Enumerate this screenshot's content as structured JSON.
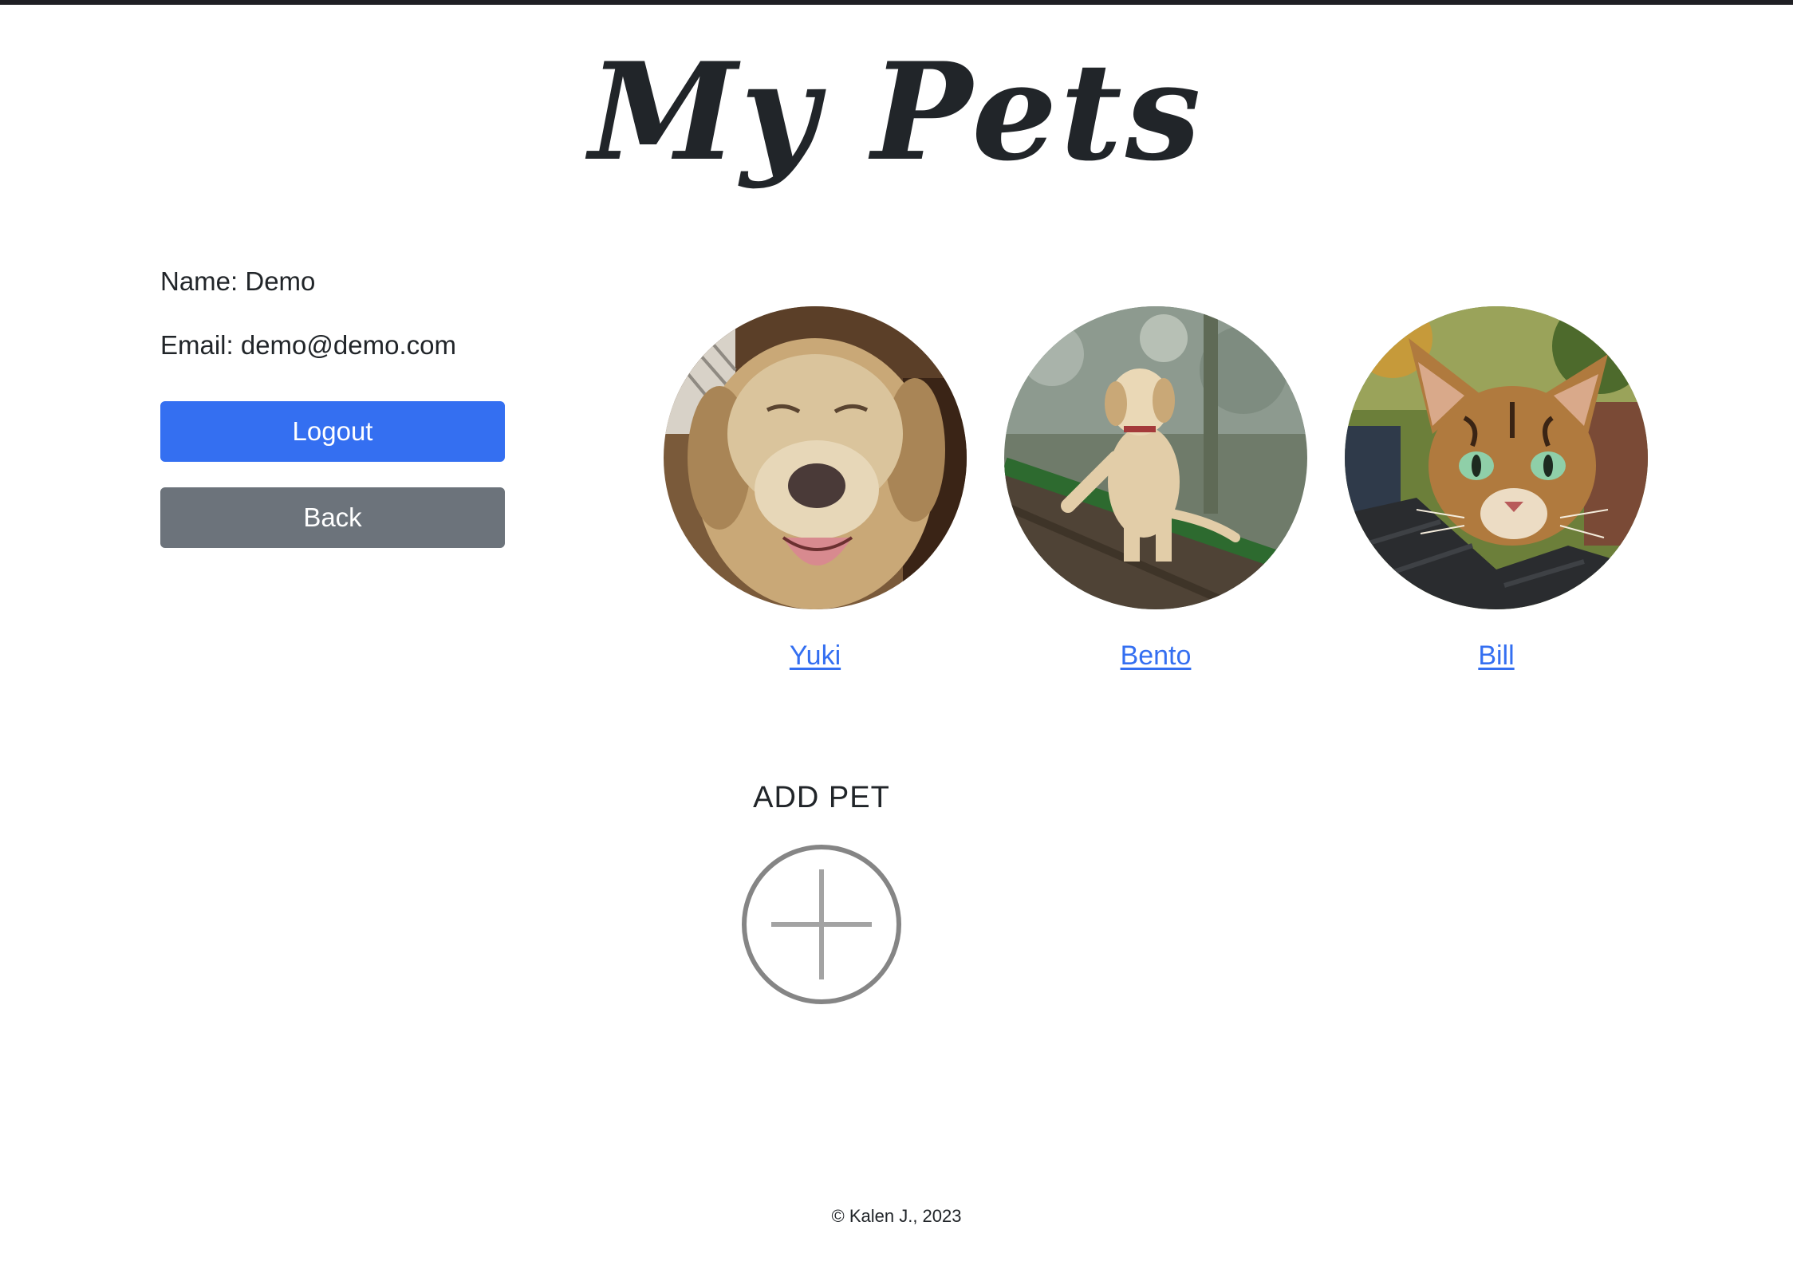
{
  "header": {
    "title": "My Pets"
  },
  "profile": {
    "name_line": "Name: Demo",
    "email_line": "Email: demo@demo.com",
    "logout_label": "Logout",
    "back_label": "Back"
  },
  "pets": [
    {
      "name": "Yuki",
      "photo": "yellow-labrador-photo"
    },
    {
      "name": "Bento",
      "photo": "puppy-on-log-photo"
    },
    {
      "name": "Bill",
      "photo": "bengal-cat-photo"
    }
  ],
  "add_pet": {
    "title": "ADD PET",
    "icon": "plus-circle-icon"
  },
  "footer": {
    "text": "© Kalen J., 2023"
  },
  "colors": {
    "primary": "#346ff1",
    "secondary": "#6c737b",
    "text": "#212529",
    "top_bar": "#1f1f24"
  }
}
